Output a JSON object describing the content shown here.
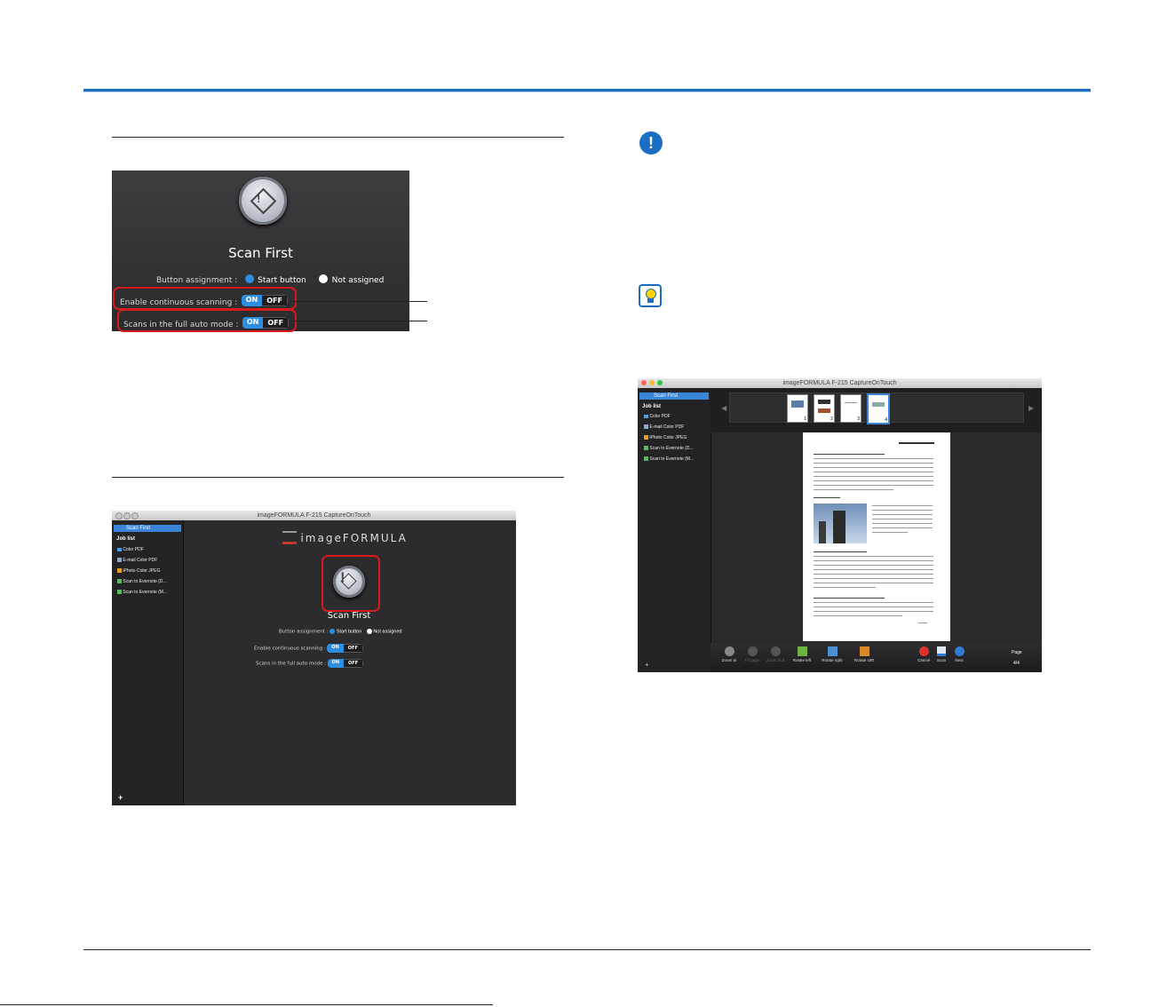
{
  "panel_scan_first": {
    "title": "Scan First",
    "button_assignment_label": "Button assignment :",
    "start_button": "Start button",
    "not_assigned": "Not assigned",
    "continuous_label": "Enable continuous scanning :",
    "full_auto_label": "Scans in the full auto mode :",
    "on": "ON",
    "off": "OFF"
  },
  "app_window": {
    "window_title": "imageFORMULA F-215 CaptureOnTouch",
    "logo_text": "imageFORMULA",
    "selected_item": "Scan First",
    "job_list_heading": "Job list",
    "jobs": [
      "Color PDF",
      "E-mail Color PDF",
      "iPhoto Color JPEG",
      "Scan to Evernote (D...",
      "Scan to Evernote (M..."
    ],
    "title": "Scan First",
    "button_assignment_label": "Button assignment :",
    "start_button": "Start button",
    "not_assigned": "Not assigned",
    "continuous_label": "Enable continuous scanning :",
    "full_auto_label": "Scans in the full auto mode :",
    "on": "ON",
    "off": "OFF",
    "add": "+"
  },
  "preview_window": {
    "window_title": "imageFORMULA F-215 CaptureOnTouch",
    "selected_item": "Scan First",
    "job_list_heading": "Job list",
    "jobs": [
      "Color PDF",
      "E-mail Color PDF",
      "iPhoto Color JPEG",
      "Scan to Evernote (D...",
      "Scan to Evernote (M..."
    ],
    "thumb_numbers": [
      "1",
      "2",
      "3",
      "4"
    ],
    "toolbar": {
      "zoom_in": "Zoom In",
      "fit_page": "Fit page",
      "zoom_out": "Zoom Out",
      "rotate_left": "Rotate left",
      "rotate_right": "Rotate right",
      "rotate_180": "Rotate 180",
      "cancel": "Cancel",
      "scan": "Scan",
      "next": "Next"
    },
    "page_label": "Page",
    "page_value": "4/4",
    "add": "+"
  },
  "icons": {
    "important": "exclamation-icon",
    "hint": "lightbulb-icon"
  },
  "colors": {
    "accent_blue": "#1b6ec2",
    "highlight_red": "#d91a1a",
    "toggle_on": "#2d8ee0"
  }
}
